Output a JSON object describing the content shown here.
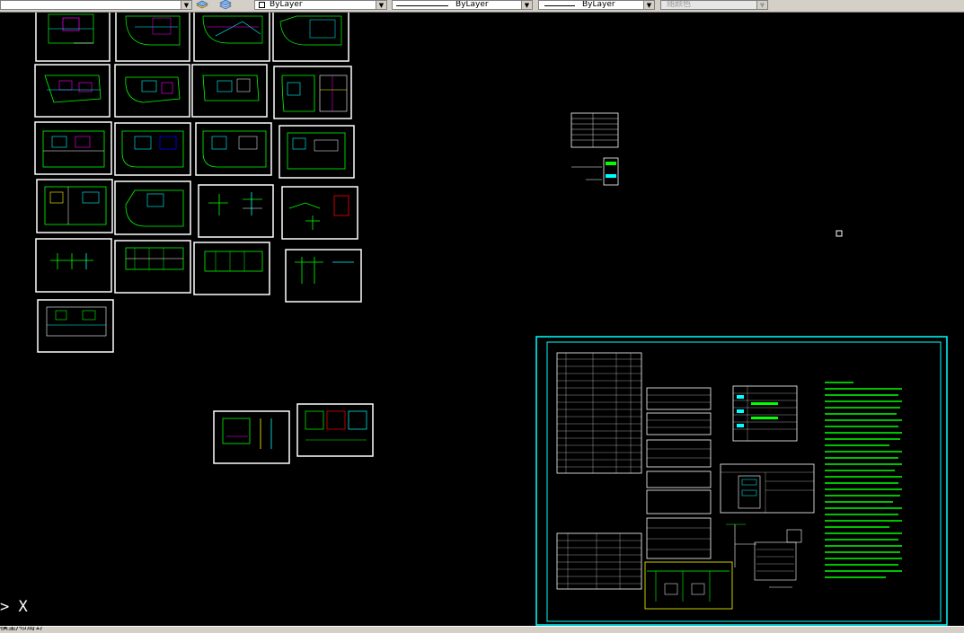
{
  "toolbar": {
    "layer_combo_value": "",
    "color_combo_value": "ByLayer",
    "linetype_combo_value": "ByLayer",
    "lineweight_combo_value": "ByLayer",
    "plotstyle_combo_value": "随颜色",
    "dropdown_arrow": "▼",
    "icons": [
      "layer-manager-icon",
      "layer-states-icon"
    ]
  },
  "canvas": {
    "background": "#000000",
    "colors": {
      "border": "#ffffff",
      "wire_green": "#00ff00",
      "cyan": "#00ffff",
      "magenta": "#ff00ff",
      "yellow": "#ffff00",
      "red": "#ff0000",
      "blue": "#0000ff"
    }
  },
  "command": {
    "prompt": "> X",
    "tabs": "模型/布局1/"
  }
}
